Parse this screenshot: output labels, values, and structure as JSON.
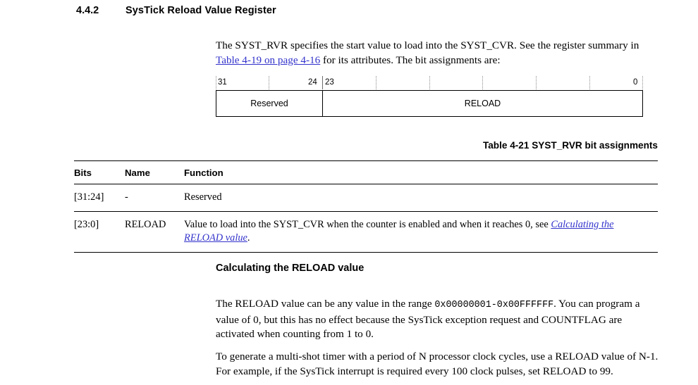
{
  "section": {
    "number": "4.4.2",
    "title": "SysTick Reload Value Register"
  },
  "intro": {
    "part1": "The SYST_RVR specifies the start value to load into the SYST_CVR. See the register summary in ",
    "link": "Table 4-19 on page 4-16",
    "part2": " for its attributes. The bit assignments are:"
  },
  "bitfield": {
    "label_31": "31",
    "label_24": "24",
    "label_23": "23",
    "label_0": "0",
    "field_reserved": "Reserved",
    "field_reload": "RELOAD"
  },
  "table": {
    "caption": "Table 4-21 SYST_RVR bit assignments",
    "headers": [
      "Bits",
      "Name",
      "Function"
    ],
    "rows": [
      {
        "bits": "[31:24]",
        "name": "-",
        "function_text": "Reserved",
        "function_link": ""
      },
      {
        "bits": "[23:0]",
        "name": "RELOAD",
        "function_text": "Value to load into the SYST_CVR when the counter is enabled and when it reaches 0, see ",
        "function_link": "Calculating the RELOAD value",
        "function_tail": "."
      }
    ]
  },
  "subsection": {
    "heading": "Calculating the RELOAD value",
    "paragraph1_a": "The RELOAD value can be any value in the range ",
    "paragraph1_range": "0x00000001-0x00FFFFFF",
    "paragraph1_b": ". You can program a value of 0, but this has no effect because the SysTick exception request and COUNTFLAG are activated when counting from 1 to 0.",
    "paragraph2": "To generate a multi-shot timer with a period of N processor clock cycles, use a RELOAD value of N-1. For example, if the SysTick interrupt is required every 100 clock pulses, set RELOAD to 99."
  },
  "colors": {
    "link": "#3333CC",
    "rule": "#000000"
  }
}
